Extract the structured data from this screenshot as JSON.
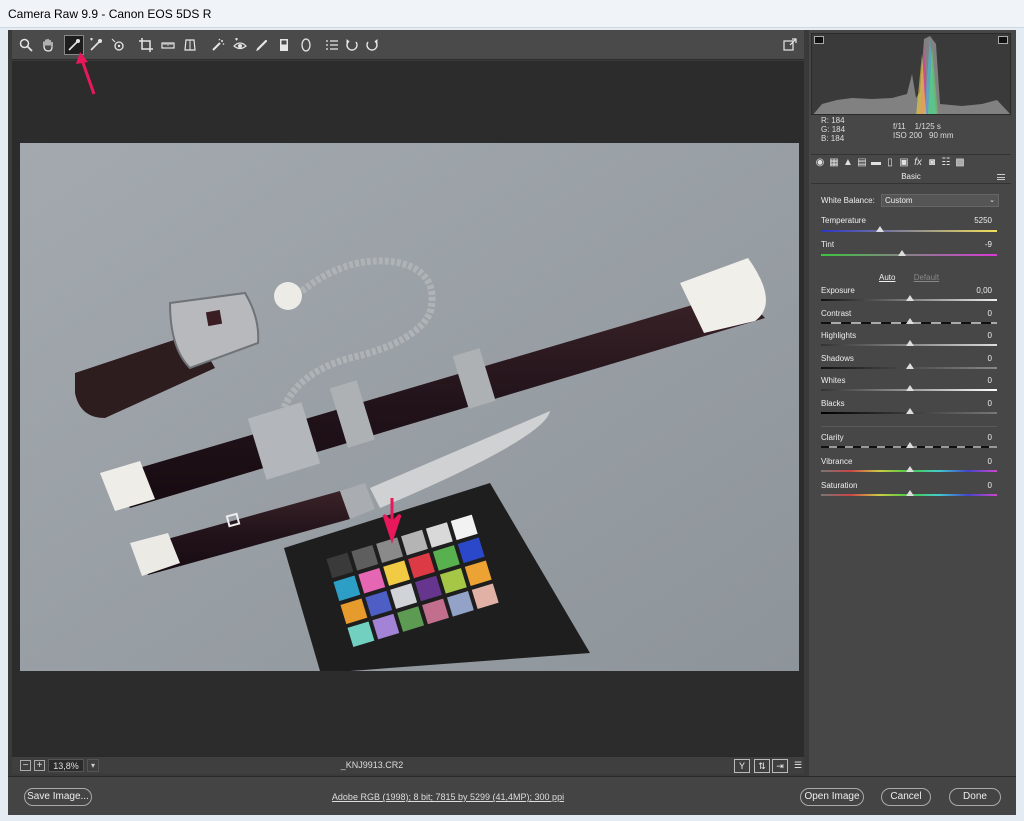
{
  "window": {
    "title": "Camera Raw 9.9  -  Canon EOS 5DS R"
  },
  "toolbar": {
    "tools": [
      {
        "name": "zoom-tool",
        "glyph": "🔍"
      },
      {
        "name": "hand-tool",
        "glyph": "✋"
      },
      {
        "name": "white-balance-tool",
        "glyph": "✒"
      },
      {
        "name": "color-sampler-tool",
        "glyph": "✒"
      },
      {
        "name": "targeted-adjustment-tool",
        "glyph": "◎"
      },
      {
        "name": "crop-tool",
        "glyph": "⌗"
      },
      {
        "name": "straighten-tool",
        "glyph": "▭"
      },
      {
        "name": "transform-tool",
        "glyph": "◫"
      },
      {
        "name": "spot-removal-tool",
        "glyph": "✎"
      },
      {
        "name": "red-eye-removal-tool",
        "glyph": "👁"
      },
      {
        "name": "adjustment-brush-tool",
        "glyph": "🖌"
      },
      {
        "name": "graduated-filter-tool",
        "glyph": "▮"
      },
      {
        "name": "radial-filter-tool",
        "glyph": "◯"
      },
      {
        "name": "preferences-tool",
        "glyph": "☰"
      },
      {
        "name": "rotate-ccw-tool",
        "glyph": "↺"
      },
      {
        "name": "rotate-cw-tool",
        "glyph": "↻"
      }
    ],
    "fullscreen_glyph": "⇱"
  },
  "preview": {
    "zoom": "13,8%",
    "zoom_minus": "−",
    "zoom_plus": "+",
    "filename": "_KNJ9913.CR2",
    "before_after": "Y"
  },
  "histogram": {
    "rgb": {
      "r_label": "R:",
      "r": "184",
      "g_label": "G:",
      "g": "184",
      "b_label": "B:",
      "b": "184"
    },
    "aperture": "f/11",
    "shutter": "1/125 s",
    "iso": "ISO 200",
    "focal": "90 mm"
  },
  "panel": {
    "title": "Basic",
    "white_balance_label": "White Balance:",
    "white_balance_value": "Custom",
    "temperature_label": "Temperature",
    "temperature_value": "5250",
    "tint_label": "Tint",
    "tint_value": "-9",
    "auto_label": "Auto",
    "default_label": "Default",
    "exposure_label": "Exposure",
    "exposure_value": "0,00",
    "contrast_label": "Contrast",
    "contrast_value": "0",
    "highlights_label": "Highlights",
    "highlights_value": "0",
    "shadows_label": "Shadows",
    "shadows_value": "0",
    "whites_label": "Whites",
    "whites_value": "0",
    "blacks_label": "Blacks",
    "blacks_value": "0",
    "clarity_label": "Clarity",
    "clarity_value": "0",
    "vibrance_label": "Vibrance",
    "vibrance_value": "0",
    "saturation_label": "Saturation",
    "saturation_value": "0"
  },
  "bottom": {
    "save_label": "Save Image...",
    "workflow_label": "Adobe RGB (1998); 8 bit; 7815 by 5299 (41,4MP); 300 ppi",
    "open_label": "Open Image",
    "cancel_label": "Cancel",
    "done_label": "Done"
  },
  "annotations": {
    "arrow_color": "#e8185a"
  }
}
